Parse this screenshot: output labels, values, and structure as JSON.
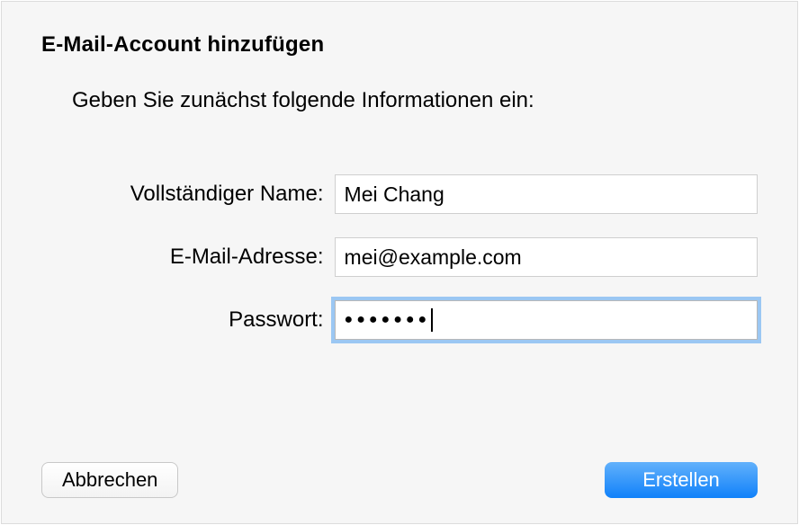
{
  "dialog": {
    "title": "E-Mail-Account hinzufügen",
    "instruction": "Geben Sie zunächst folgende Informationen ein:"
  },
  "form": {
    "fullname": {
      "label": "Vollständiger Name:",
      "value": "Mei Chang"
    },
    "email": {
      "label": "E-Mail-Adresse:",
      "value": "mei@example.com"
    },
    "password": {
      "label": "Passwort:",
      "mask": "●●●●●●●"
    }
  },
  "buttons": {
    "cancel": "Abbrechen",
    "create": "Erstellen"
  }
}
